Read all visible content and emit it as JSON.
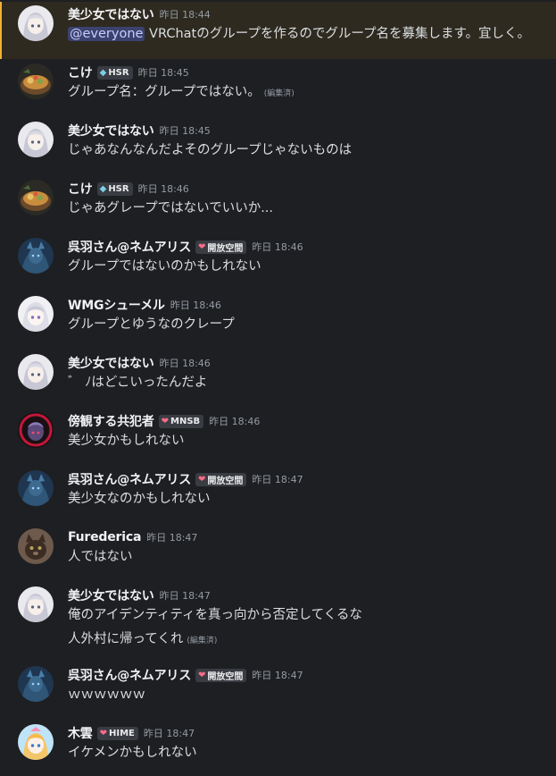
{
  "edited_label": "(編集済)",
  "users": {
    "bishoujo": {
      "name": "美少女ではない"
    },
    "koke": {
      "name": "こけ",
      "tag": "HSR",
      "tag_icon": "diamond-icon"
    },
    "kureha": {
      "name": "呉羽さん@ネムアリス",
      "tag": "開放空間",
      "tag_icon": "heart-icon"
    },
    "wmg": {
      "name": "WMGシューメル"
    },
    "bokan": {
      "name": "傍観する共犯者",
      "tag": "MNSB",
      "tag_icon": "heart-icon"
    },
    "furederica": {
      "name": "Furederica"
    },
    "kigumo": {
      "name": "木雲",
      "tag": "HIME",
      "tag_icon": "heart-icon"
    }
  },
  "messages": [
    {
      "user": "bishoujo",
      "timestamp": "昨日 18:44",
      "mention_highlight": true,
      "mention": "@everyone",
      "text": " VRChatのグループを作るのでグループ名を募集します。宜しく。"
    },
    {
      "user": "koke",
      "timestamp": "昨日 18:45",
      "text": "グループ名：グループではない。",
      "edited": true
    },
    {
      "user": "bishoujo",
      "timestamp": "昨日 18:45",
      "text": "じゃあなんなんだよそのグループじゃないものは"
    },
    {
      "user": "koke",
      "timestamp": "昨日 18:46",
      "text": "じゃあグレープではないでいいか..."
    },
    {
      "user": "kureha",
      "timestamp": "昨日 18:46",
      "text": "グループではないのかもしれない"
    },
    {
      "user": "wmg",
      "timestamp": "昨日 18:46",
      "text": "グループとゆうなのクレープ"
    },
    {
      "user": "bishoujo",
      "timestamp": "昨日 18:46",
      "text": "゛ ﾉはどこいったんだよ"
    },
    {
      "user": "bokan",
      "timestamp": "昨日 18:46",
      "text": "美少女かもしれない"
    },
    {
      "user": "kureha",
      "timestamp": "昨日 18:47",
      "text": "美少女なのかもしれない"
    },
    {
      "user": "furederica",
      "timestamp": "昨日 18:47",
      "text": "人ではない"
    },
    {
      "user": "bishoujo",
      "timestamp": "昨日 18:47",
      "text": "俺のアイデンティティを真っ向から否定してくるな",
      "text2": "人外村に帰ってくれ",
      "edited2": true
    },
    {
      "user": "kureha",
      "timestamp": "昨日 18:47",
      "text": "ｗｗｗｗｗｗ"
    },
    {
      "user": "kigumo",
      "timestamp": "昨日 18:47",
      "text": "イケメンかもしれない"
    }
  ],
  "colors": {
    "background": "#1e1f22",
    "mention_background": "#2e2a20",
    "mention_bar": "#f0b232",
    "mention_pill": "#3c4270",
    "username": "#f2f3f5",
    "text": "#dbdee1",
    "muted": "#949ba4"
  }
}
